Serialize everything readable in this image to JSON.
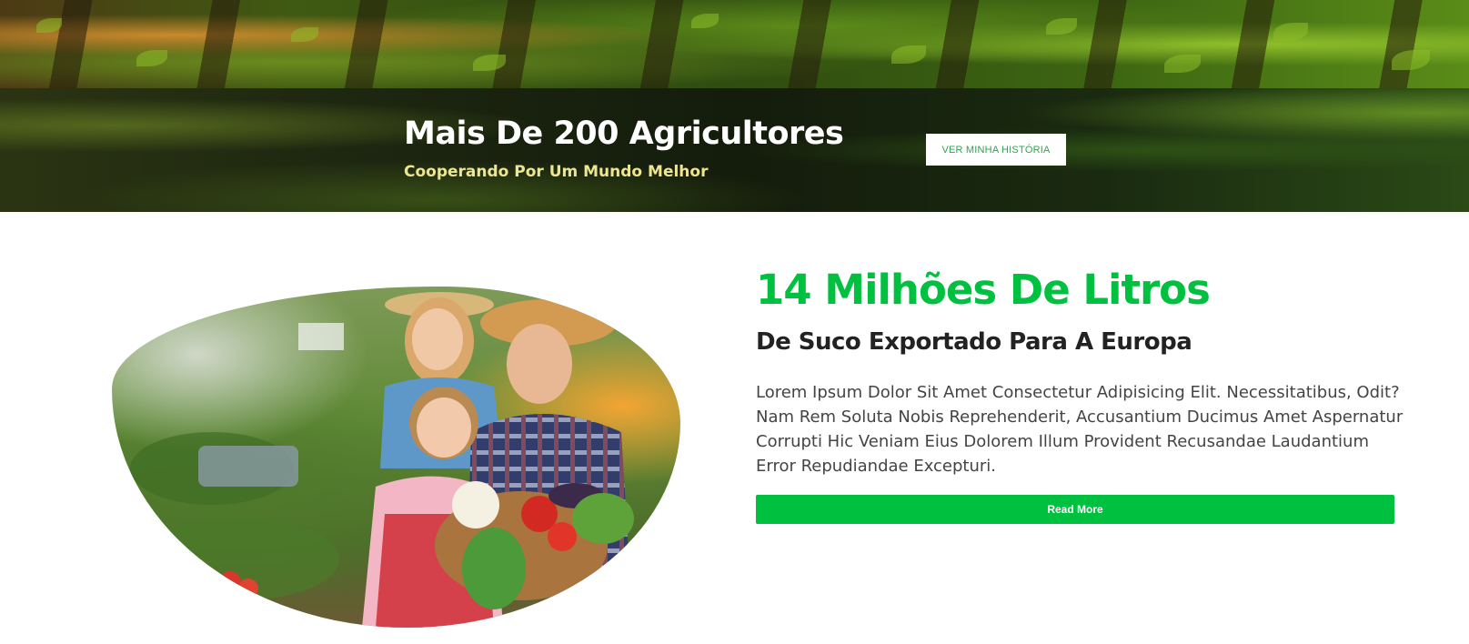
{
  "banner": {
    "title": "Mais De 200 Agricultores",
    "subtitle": "Cooperando Por Um Mundo Melhor",
    "story_button_label": "VER MINHA HISTÓRIA"
  },
  "feature": {
    "heading": "14 Milhões De Litros",
    "subheading": "De Suco Exportado Para A Europa",
    "paragraph": "Lorem Ipsum Dolor Sit Amet Consectetur Adipisicing Elit. Necessitatibus, Odit? Nam Rem Soluta Nobis Reprehenderit, Accusantium Ducimus Amet Aspernatur Corrupti Hic Veniam Eius Dolorem Illum Provident Recusandae Laudantium Error Repudiandae Excepturi.",
    "read_more_label": "Read More"
  },
  "colors": {
    "accent_green": "#00c040",
    "subtitle_yellow": "#ede58f",
    "heading_dark": "#222222"
  }
}
